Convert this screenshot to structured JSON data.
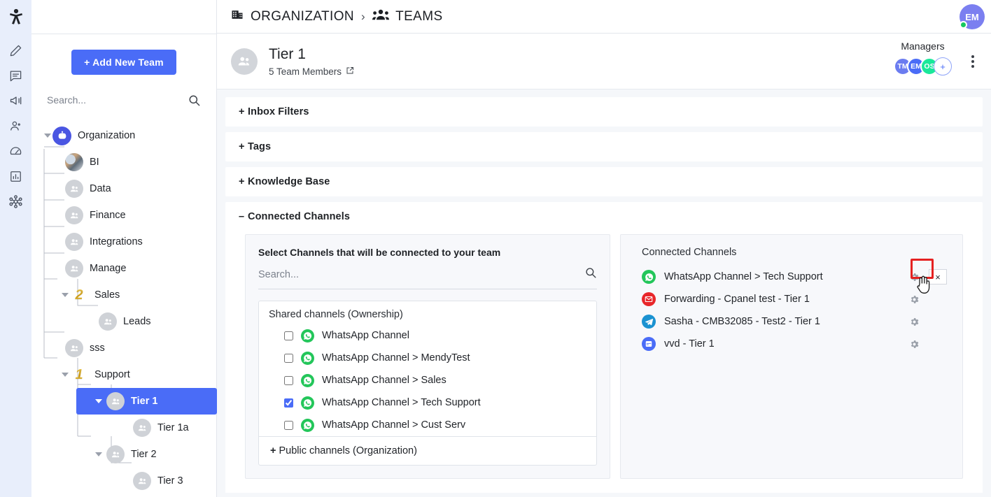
{
  "rail": {
    "logo_icon": "brand-logo-icon",
    "items": [
      {
        "icon": "pencil-icon",
        "name": "rail-item-compose"
      },
      {
        "icon": "chat-icon",
        "name": "rail-item-conversations"
      },
      {
        "icon": "megaphone-icon",
        "name": "rail-item-campaigns"
      },
      {
        "icon": "contacts-icon",
        "name": "rail-item-contacts"
      },
      {
        "icon": "gauge-icon",
        "name": "rail-item-performance"
      },
      {
        "icon": "bar-chart-icon",
        "name": "rail-item-reports"
      },
      {
        "icon": "network-icon",
        "name": "rail-item-organization"
      }
    ]
  },
  "topbar": {
    "breadcrumb_org": "ORGANIZATION",
    "breadcrumb_sep": "›",
    "breadcrumb_teams": "TEAMS",
    "user_initials": "EM",
    "status": "online"
  },
  "sidebar": {
    "add_team_label": "+ Add New Team",
    "search_placeholder": "Search...",
    "search_value": "",
    "tree": [
      {
        "label": "Organization",
        "depth": 0,
        "icon": "bot-avatar",
        "expanded": true
      },
      {
        "label": "BI",
        "depth": 1,
        "icon": "photo-avatar"
      },
      {
        "label": "Data",
        "depth": 1,
        "icon": "team-avatar"
      },
      {
        "label": "Finance",
        "depth": 1,
        "icon": "team-avatar"
      },
      {
        "label": "Integrations",
        "depth": 1,
        "icon": "team-avatar"
      },
      {
        "label": "Manage",
        "depth": 1,
        "icon": "team-avatar"
      },
      {
        "label": "Sales",
        "depth": 1,
        "icon": "number-badge",
        "badge": "2",
        "expanded": true
      },
      {
        "label": "Leads",
        "depth": 2,
        "icon": "team-avatar"
      },
      {
        "label": "sss",
        "depth": 1,
        "icon": "team-avatar"
      },
      {
        "label": "Support",
        "depth": 1,
        "icon": "number-badge",
        "badge": "1",
        "expanded": true
      },
      {
        "label": "Tier 1",
        "depth": 2,
        "icon": "team-avatar",
        "expanded": true,
        "selected": true
      },
      {
        "label": "Tier 1a",
        "depth": 3,
        "icon": "team-avatar"
      },
      {
        "label": "Tier 2",
        "depth": 2,
        "icon": "team-avatar",
        "expanded": true
      },
      {
        "label": "Tier 3",
        "depth": 3,
        "icon": "team-avatar"
      }
    ]
  },
  "team_header": {
    "title": "Tier 1",
    "members_text": "5 Team Members",
    "members_link_icon": "external-link-icon",
    "managers_label": "Managers",
    "managers": [
      {
        "initials": "TM",
        "color": "#6b7cf0"
      },
      {
        "initials": "EM",
        "color": "#4a6cf7"
      },
      {
        "initials": "OS",
        "color": "#1ae89a"
      },
      {
        "initials": "+",
        "color": "#ffffff"
      }
    ],
    "menu_icon": "kebab-menu-icon"
  },
  "accordions": [
    {
      "sign": "+",
      "label": "Inbox Filters",
      "open": false
    },
    {
      "sign": "+",
      "label": "Tags",
      "open": false
    },
    {
      "sign": "+",
      "label": "Knowledge Base",
      "open": false
    },
    {
      "sign": "–",
      "label": "Connected Channels",
      "open": true
    }
  ],
  "channel_selector": {
    "title": "Select Channels that will be connected to your team",
    "search_placeholder": "Search...",
    "search_value": "",
    "group_label": "Shared channels (Ownership)",
    "items": [
      {
        "label": "WhatsApp Channel",
        "checked": false,
        "icon": "whatsapp-icon"
      },
      {
        "label": "WhatsApp Channel > MendyTest",
        "checked": false,
        "icon": "whatsapp-icon"
      },
      {
        "label": "WhatsApp Channel > Sales",
        "checked": false,
        "icon": "whatsapp-icon"
      },
      {
        "label": "WhatsApp Channel > Tech Support",
        "checked": true,
        "icon": "whatsapp-icon"
      },
      {
        "label": "WhatsApp Channel > Cust Serv",
        "checked": false,
        "icon": "whatsapp-icon"
      }
    ],
    "footer_sign": "+",
    "footer_label": "Public channels (Organization)"
  },
  "connected_channels": {
    "title": "Connected Channels",
    "items": [
      {
        "label": "WhatsApp Channel > Tech Support",
        "icon": "whatsapp-icon",
        "icon_color": "#23c65a",
        "has_remove": true
      },
      {
        "label": "Forwarding - Cpanel test - Tier 1",
        "icon": "email-icon",
        "icon_color": "#e8262a",
        "has_remove": false
      },
      {
        "label": "Sasha - CMB32085 - Test2 - Tier 1",
        "icon": "telegram-icon",
        "icon_color": "#1b92d1",
        "has_remove": false
      },
      {
        "label": "vvd - Tier 1",
        "icon": "webchat-icon",
        "icon_color": "#4a6cf7",
        "has_remove": false
      }
    ],
    "gear_icon": "gear-icon",
    "remove_label": "×",
    "highlight_color": "#e52121"
  }
}
